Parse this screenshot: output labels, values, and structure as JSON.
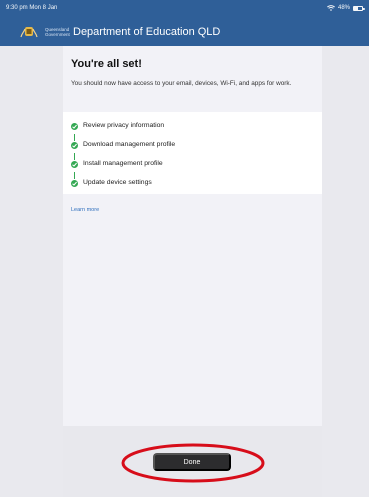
{
  "status_bar": {
    "time_date": "9:30 pm  Mon 8 Jan",
    "battery_text": "48%",
    "battery_level": 0.48
  },
  "header": {
    "government_text": "Queensland Government",
    "title": "Department of Education QLD",
    "background_color": "#2f5f98",
    "logo_icon": "queensland-crest-icon"
  },
  "main": {
    "title": "You're all set!",
    "description": "You should now have access to your email, devices, Wi-Fi, and apps for work.",
    "checklist": [
      {
        "label": "Review privacy information",
        "status": "complete"
      },
      {
        "label": "Download management profile",
        "status": "complete"
      },
      {
        "label": "Install management profile",
        "status": "complete"
      },
      {
        "label": "Update device settings",
        "status": "complete"
      }
    ],
    "learn_more_label": "Learn more",
    "check_color": "#34a853",
    "link_color": "#2f6fbd"
  },
  "footer": {
    "done_label": "Done",
    "annotation_color": "#d70d1a"
  }
}
